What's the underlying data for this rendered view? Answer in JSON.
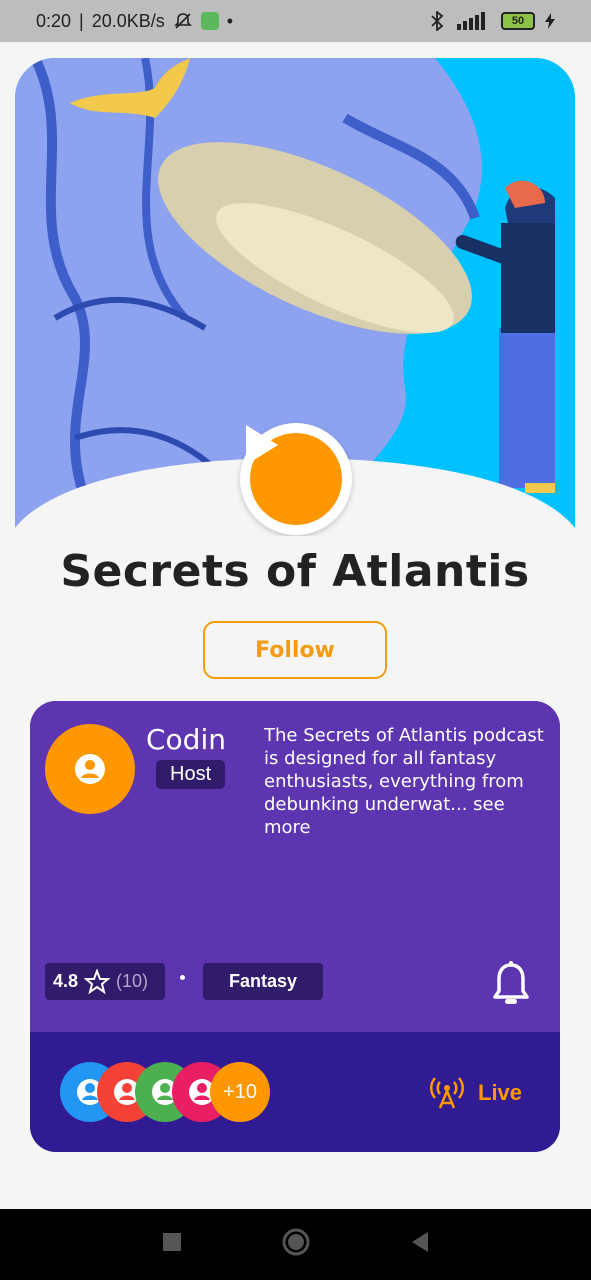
{
  "status_bar": {
    "time": "0:20",
    "speed": "20.0KB/s",
    "battery": "50",
    "icons": [
      "mute-bell-icon",
      "app-notification-icon",
      "bluetooth-icon",
      "signal-icon",
      "charging-icon"
    ]
  },
  "podcast": {
    "title": "Secrets of Atlantis",
    "follow_label": "Follow",
    "play_icon": "play-icon"
  },
  "host": {
    "name": "Codin",
    "role": "Host",
    "description": "The Secrets of Atlantis podcast is designed for all fantasy enthusiasts, everything from debunking underwat...",
    "see_more": "see more"
  },
  "meta": {
    "rating": "4.8",
    "rating_count": "(10)",
    "genre": "Fantasy"
  },
  "listeners": {
    "more_count": "+10",
    "colors": [
      "#2196f3",
      "#f44336",
      "#4caf50",
      "#e91e63"
    ]
  },
  "live_label": "Live",
  "colors": {
    "accent": "#ff9800",
    "card": "#5e35b1",
    "card_dark": "#311b92",
    "sky": "#00c1ff"
  }
}
